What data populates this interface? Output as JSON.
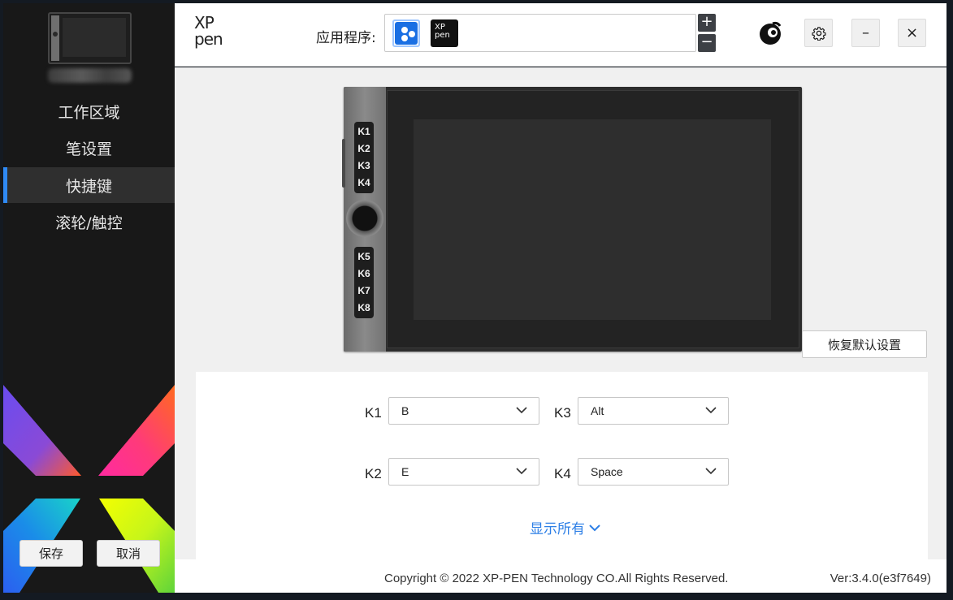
{
  "sidebar": {
    "nav": [
      {
        "label": "工作区域",
        "active": false
      },
      {
        "label": "笔设置",
        "active": false
      },
      {
        "label": "快捷键",
        "active": true
      },
      {
        "label": "滚轮/触控",
        "active": false
      }
    ],
    "save_label": "保存",
    "cancel_label": "取消"
  },
  "header": {
    "logo_line1": "XP",
    "logo_line2": "pen",
    "app_label": "应用程序:",
    "app_icon_2_line1": "XP",
    "app_icon_2_line2": "pen",
    "plus": "+",
    "minus": "−",
    "min_label": "–",
    "close_label": "×"
  },
  "tablet": {
    "keys_top": [
      "K1",
      "K2",
      "K3",
      "K4"
    ],
    "keys_bottom": [
      "K5",
      "K6",
      "K7",
      "K8"
    ]
  },
  "reset_label": "恢复默认设置",
  "shortcuts": {
    "k1": {
      "label": "K1",
      "value": "B"
    },
    "k2": {
      "label": "K2",
      "value": "E"
    },
    "k3": {
      "label": "K3",
      "value": "Alt"
    },
    "k4": {
      "label": "K4",
      "value": "Space"
    }
  },
  "show_all_label": "显示所有",
  "footer": {
    "copyright": "Copyright © 2022  XP-PEN Technology CO.All Rights Reserved.",
    "version": "Ver:3.4.0(e3f7649)"
  },
  "colors": {
    "accent": "#2f8af5",
    "link": "#2d7fe6",
    "sidebar_bg": "#181818",
    "sidebar_active": "#2f2f2f"
  }
}
